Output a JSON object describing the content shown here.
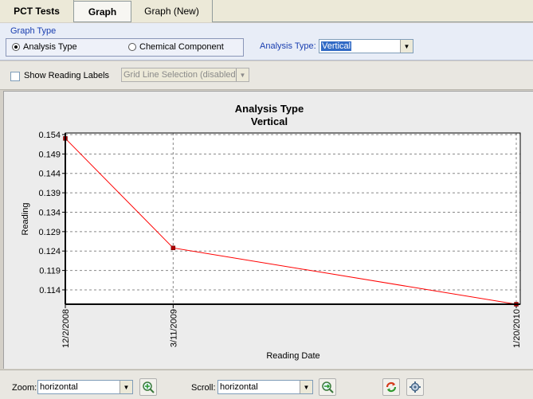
{
  "tabs": [
    {
      "label": "PCT Tests",
      "active": false
    },
    {
      "label": "Graph",
      "active": true
    },
    {
      "label": "Graph (New)",
      "active": false
    }
  ],
  "graph_type": {
    "title": "Graph Type",
    "options": [
      {
        "label": "Analysis Type",
        "selected": true
      },
      {
        "label": "Chemical Component",
        "selected": false
      }
    ],
    "analysis_type_label": "Analysis Type:",
    "analysis_type_value": "Vertical"
  },
  "options_row": {
    "show_reading_labels": "Show Reading Labels",
    "show_reading_labels_checked": false,
    "grid_line_selection": "Grid Line Selection (disabled)"
  },
  "bottom": {
    "zoom_label": "Zoom:",
    "zoom_value": "horizontal",
    "scroll_label": "Scroll:",
    "scroll_value": "horizontal"
  },
  "colors": {
    "series": "#ff0000",
    "marker": "#b00000",
    "grid": "#888888"
  },
  "chart_data": {
    "type": "line",
    "title": "Analysis Type",
    "subtitle": "Vertical",
    "xlabel": "Reading Date",
    "ylabel": "Reading",
    "grid": true,
    "x": [
      "12/2/2008",
      "3/11/2009",
      "1/20/2010"
    ],
    "x_days": [
      0,
      99,
      414
    ],
    "series": [
      {
        "values": [
          0.153,
          0.1248,
          0.1103
        ]
      }
    ],
    "yticks": [
      0.114,
      0.119,
      0.124,
      0.129,
      0.134,
      0.139,
      0.144,
      0.149,
      0.154
    ],
    "ylim": [
      0.1103,
      0.1544
    ]
  }
}
